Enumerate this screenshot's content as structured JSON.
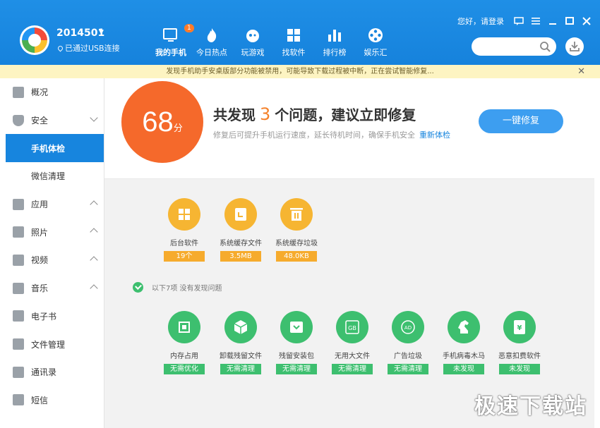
{
  "device": {
    "name": "2014501",
    "status": "已通过USB连接"
  },
  "nav": [
    {
      "label": "我的手机",
      "icon": "phone-icon",
      "badge": "1"
    },
    {
      "label": "今日热点",
      "icon": "flame-icon"
    },
    {
      "label": "玩游戏",
      "icon": "gamepad-icon"
    },
    {
      "label": "找软件",
      "icon": "apps-grid-icon"
    },
    {
      "label": "排行榜",
      "icon": "bar-chart-icon"
    },
    {
      "label": "娱乐汇",
      "icon": "film-reel-icon"
    }
  ],
  "window": {
    "login_text": "您好，请登录"
  },
  "notice": {
    "text": "发现手机助手安桌版部分功能被禁用，可能导致下载过程被中断，正在尝试智能修复..."
  },
  "sidebar": {
    "items": [
      {
        "label": "概况",
        "icon": "overview-icon"
      },
      {
        "label": "安全",
        "icon": "shield-icon"
      },
      {
        "label": "手机体检"
      },
      {
        "label": "微信清理"
      },
      {
        "label": "应用",
        "icon": "apps-icon"
      },
      {
        "label": "照片",
        "icon": "photo-icon"
      },
      {
        "label": "视频",
        "icon": "video-icon"
      },
      {
        "label": "音乐",
        "icon": "music-icon"
      },
      {
        "label": "电子书",
        "icon": "book-icon"
      },
      {
        "label": "文件管理",
        "icon": "folder-icon"
      },
      {
        "label": "通讯录",
        "icon": "contacts-icon"
      },
      {
        "label": "短信",
        "icon": "sms-icon"
      }
    ]
  },
  "score": {
    "value": "68",
    "unit": "分"
  },
  "summary": {
    "prefix": "共发现",
    "count": "3",
    "suffix": "个问题，建议立即修复",
    "sub": "修复后可提升手机运行速度，延长待机时间，确保手机安全",
    "rescan": "重新体检",
    "fix_button": "一键修复"
  },
  "issues": [
    {
      "name": "后台软件",
      "value": "19个",
      "icon": "background-apps-icon"
    },
    {
      "name": "系统缓存文件",
      "value": "3.5MB",
      "icon": "cache-file-icon"
    },
    {
      "name": "系统缓存垃圾",
      "value": "48.0KB",
      "icon": "trash-icon"
    }
  ],
  "ok_note": "以下7项 没有发现问题",
  "checks": [
    {
      "name": "内存占用",
      "status": "无需优化",
      "icon": "memory-chip-icon"
    },
    {
      "name": "卸载残留文件",
      "status": "无需清理",
      "icon": "cube-icon"
    },
    {
      "name": "残留安装包",
      "status": "无需清理",
      "icon": "package-icon"
    },
    {
      "name": "无用大文件",
      "status": "无需清理",
      "icon": "gb-file-icon"
    },
    {
      "name": "广告垃圾",
      "status": "无需清理",
      "icon": "ad-icon"
    },
    {
      "name": "手机病毒木马",
      "status": "未发现",
      "icon": "trojan-horse-icon"
    },
    {
      "name": "恶意扣费软件",
      "status": "未发现",
      "icon": "yen-icon"
    }
  ],
  "watermark": "极速下载站"
}
